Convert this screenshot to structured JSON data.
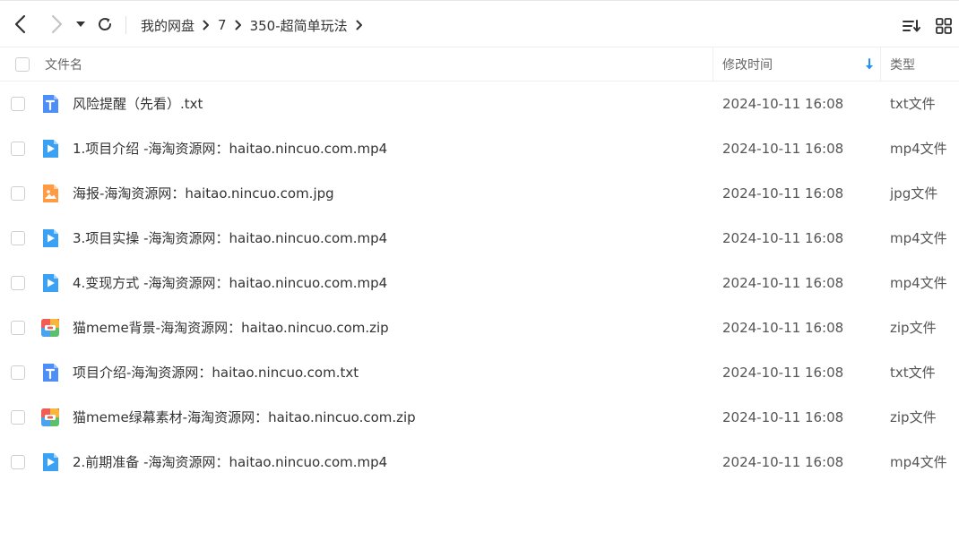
{
  "toolbar": {
    "breadcrumb": [
      {
        "label": "我的网盘"
      },
      {
        "label": "7"
      },
      {
        "label": "350-超简单玩法"
      }
    ]
  },
  "header": {
    "name": "文件名",
    "time": "修改时间",
    "type": "类型"
  },
  "colors": {
    "accent": "#1e90ff",
    "txt_icon": "#4d8ef7",
    "video_icon": "#3aa1f5",
    "image_icon": "#ff9a45"
  },
  "files": [
    {
      "icon": "txt-file-icon",
      "name": "风险提醒（先看）.txt",
      "time": "2024-10-11 16:08",
      "type": "txt文件"
    },
    {
      "icon": "video-file-icon",
      "name": "1.项目介绍 -海淘资源网：haitao.nincuo.com.mp4",
      "time": "2024-10-11 16:08",
      "type": "mp4文件"
    },
    {
      "icon": "image-file-icon",
      "name": "海报-海淘资源网：haitao.nincuo.com.jpg",
      "time": "2024-10-11 16:08",
      "type": "jpg文件"
    },
    {
      "icon": "video-file-icon",
      "name": "3.项目实操 -海淘资源网：haitao.nincuo.com.mp4",
      "time": "2024-10-11 16:08",
      "type": "mp4文件"
    },
    {
      "icon": "video-file-icon",
      "name": "4.变现方式 -海淘资源网：haitao.nincuo.com.mp4",
      "time": "2024-10-11 16:08",
      "type": "mp4文件"
    },
    {
      "icon": "zip-file-icon",
      "name": "猫meme背景-海淘资源网：haitao.nincuo.com.zip",
      "time": "2024-10-11 16:08",
      "type": "zip文件"
    },
    {
      "icon": "txt-file-icon",
      "name": "项目介绍-海淘资源网：haitao.nincuo.com.txt",
      "time": "2024-10-11 16:08",
      "type": "txt文件"
    },
    {
      "icon": "zip-file-icon",
      "name": "猫meme绿幕素材-海淘资源网：haitao.nincuo.com.zip",
      "time": "2024-10-11 16:08",
      "type": "zip文件"
    },
    {
      "icon": "video-file-icon",
      "name": "2.前期准备 -海淘资源网：haitao.nincuo.com.mp4",
      "time": "2024-10-11 16:08",
      "type": "mp4文件"
    }
  ]
}
